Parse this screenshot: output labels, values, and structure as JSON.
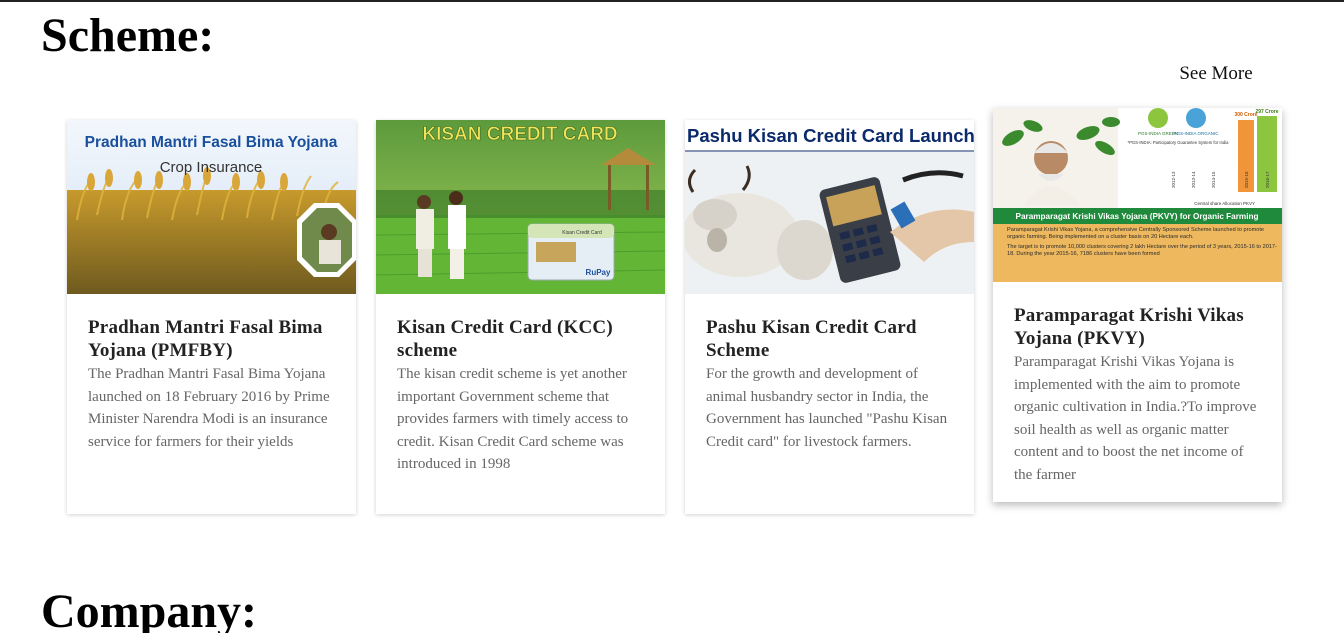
{
  "page": {
    "scheme_heading": "Scheme:",
    "see_more": "See More",
    "company_heading": "Company:"
  },
  "cards": [
    {
      "title": "Pradhan Mantri Fasal Bima Yojana (PMFBY)",
      "description": "The Pradhan Mantri Fasal Bima Yojana launched on 18 February 2016 by Prime Minister Narendra Modi is an insurance service for farmers for their yields",
      "image": {
        "line1": "Pradhan Mantri Fasal Bima Yojana",
        "line2": "Crop Insurance"
      }
    },
    {
      "title": "Kisan Credit Card (KCC) scheme",
      "description": "The kisan credit scheme is yet another important Government scheme that provides farmers with timely access to credit. Kisan Credit Card scheme was introduced in 1998",
      "image": {
        "banner": "KISAN CREDIT CARD",
        "card_label": "Kisan Credit Card",
        "card_brand": "RuPay"
      }
    },
    {
      "title": "Pashu Kisan Credit Card Scheme",
      "description": "For the growth and development of animal husbandry sector in India, the Government has launched \"Pashu Kisan Credit card\" for livestock farmers.",
      "image": {
        "banner": "Pashu Kisan Credit Card Launched"
      }
    },
    {
      "title": "Paramparagat Krishi Vikas Yojana (PKVY)",
      "description": "Paramparagat Krishi Vikas Yojana is implemented with the aim to promote organic cultivation in India.?To improve soil health as well as organic matter content and to boost the net income of the farmer",
      "image": {
        "logo1": "PGS-INDIA GREEN",
        "logo2": "PGS-INDIA ORGANIC",
        "caption": "*PGS-INDIA: Participatory Guarantee System for India",
        "years": [
          "2012-13",
          "2013-14",
          "2014-15",
          "2015-16",
          "2016-17"
        ],
        "bar_values": [
          "300 Crore",
          "297 Crore"
        ],
        "allocation_label": "Central share Allocation PKVY",
        "band": "Paramparagat Krishi Vikas Yojana (PKVY) for Organic Farming",
        "bullet1": "Paramparagat Krishi Vikas Yojana, a comprehensive Centrally Sponsored Scheme launched to promote organic farming. Being implemented on a cluster basis on 20 Hectare each.",
        "bullet2": "The target is to promote 10,000 clusters covering 2 lakh Hectare over the period of 3 years, 2015-16 to 2017-18. During the year 2015-16, 7186 clusters have been formed"
      }
    }
  ],
  "colors": {
    "pmfby_title": "#1a4f9c",
    "kcc_banner": "#f2e35a",
    "pkvy_band": "#1f8a3c",
    "pkvy_bar_orange": "#f0953a",
    "pkvy_bar_green": "#8cc63f"
  }
}
